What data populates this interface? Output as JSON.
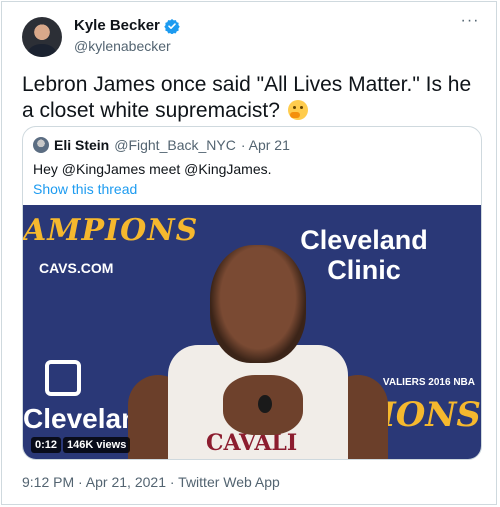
{
  "tweet": {
    "author_name": "Kyle Becker",
    "author_handle": "@kylenabecker",
    "text": "Lebron James once said \"All Lives Matter.\" Is he a closet white supremacist?",
    "meta": "9:12 PM · Apr 21, 2021 · Twitter Web App",
    "more_glyph": "···",
    "verified_color": "#1d9bf0"
  },
  "quoted": {
    "author_name": "Eli Stein",
    "author_handle": "@Fight_Back_NYC",
    "date": "· Apr 21",
    "text": "Hey @KingJames meet @KingJames.",
    "thread_link": "Show this thread",
    "link_color": "#1d9bf0"
  },
  "video": {
    "timestamp": "0:12",
    "views": "146K views",
    "backdrop": {
      "sponsor": "Cleveland Clinic",
      "champions_left": "AMPIONS",
      "cavs_url": "CAVS.COM",
      "cleveland_lower": "Cleveland",
      "champions_right": "PIONS",
      "nba_text": "VALIERS 2016 NBA",
      "jersey_text": "CAVALI"
    }
  },
  "icons": [
    "verified-icon",
    "more-options-icon",
    "thinking-face-emoji"
  ]
}
